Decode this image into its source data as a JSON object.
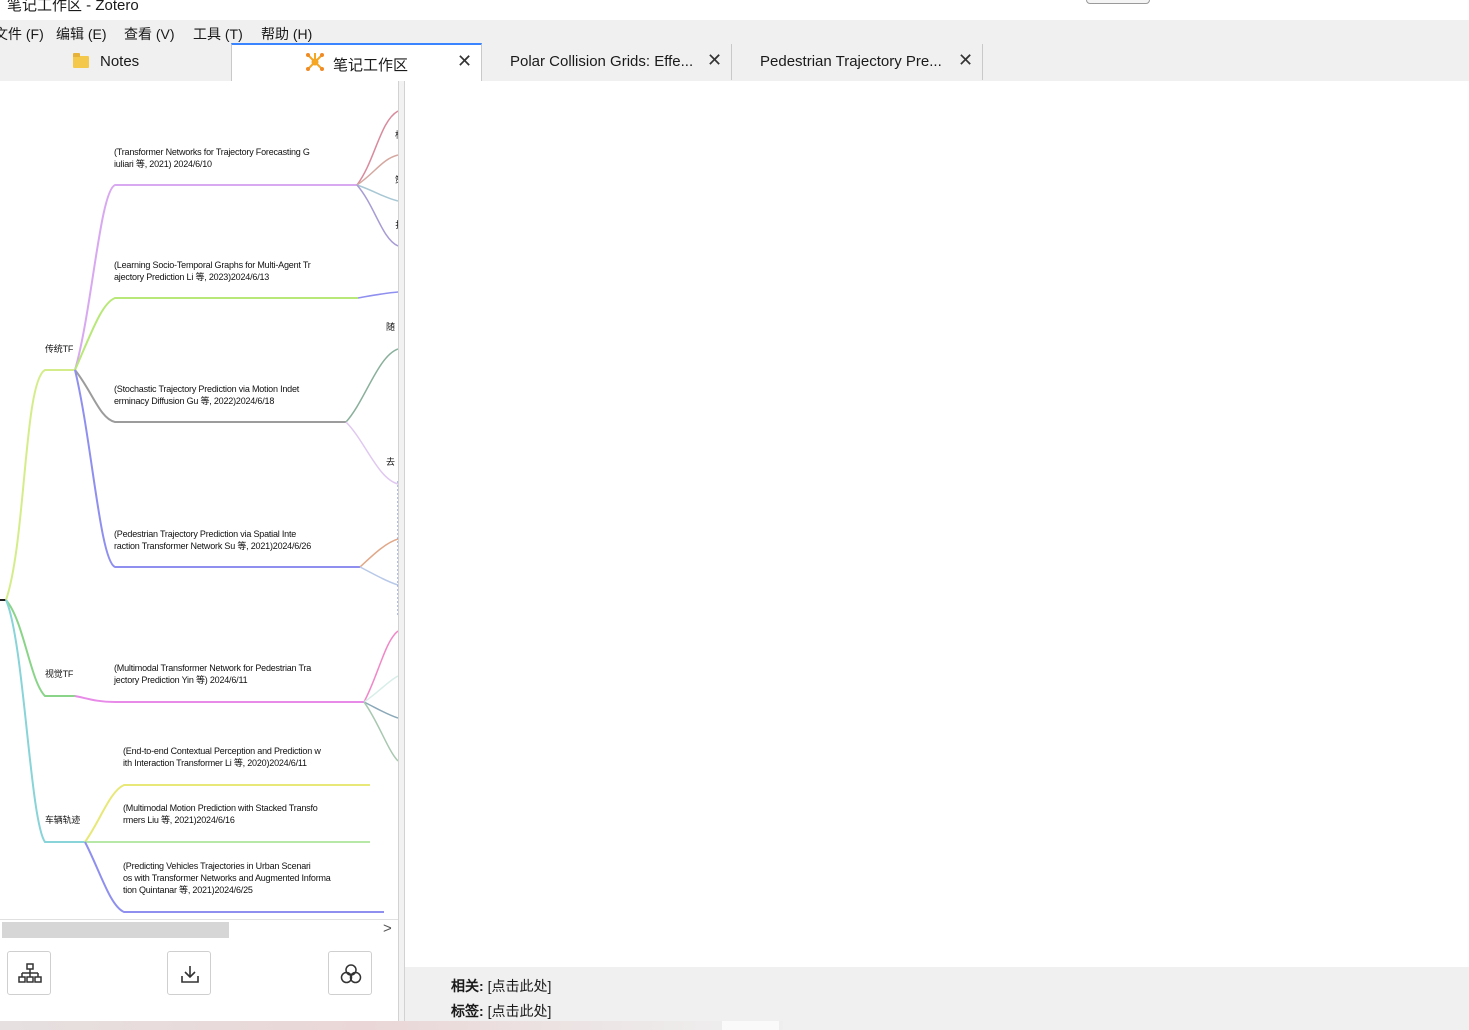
{
  "window": {
    "title": "笔记工作区 - Zotero"
  },
  "menu": {
    "file": "文件 (F)",
    "edit": "编辑 (E)",
    "view": "查看 (V)",
    "tools": "工具 (T)",
    "help": "帮助 (H)"
  },
  "tabs": [
    {
      "label": "Notes",
      "icon": "folder-icon"
    },
    {
      "label": "笔记工作区",
      "icon": "burst-icon",
      "active": true
    },
    {
      "label": "Polar Collision Grids: Effe..."
    },
    {
      "label": "Pedestrian Trajectory Pre..."
    }
  ],
  "close_glyph": "✕",
  "mindmap": {
    "branch_traditional": "传统TF",
    "branch_visual": "视觉TF",
    "branch_vehicle": "车辆轨迹",
    "nodes": [
      {
        "line1": "(Transformer Networks for Trajectory Forecasting G",
        "line2": "iuliari 等, 2021) 2024/6/10"
      },
      {
        "line1": "(Learning Socio-Temporal Graphs for Multi-Agent Tr",
        "line2": "ajectory Prediction Li 等, 2023)2024/6/13"
      },
      {
        "line1": "(Stochastic Trajectory Prediction via Motion Indet",
        "line2": "erminacy Diffusion Gu 等, 2022)2024/6/18"
      },
      {
        "line1": "(Pedestrian Trajectory Prediction via Spatial Inte",
        "line2": "raction Transformer Network Su 等, 2021)2024/6/26"
      },
      {
        "line1": "(Multimodal Transformer Network for Pedestrian Tra",
        "line2": "jectory Prediction Yin 等) 2024/6/11"
      },
      {
        "line1": "(End-to-end Contextual Perception and Prediction w",
        "line2": "ith Interaction Transformer Li 等, 2020)2024/6/11"
      },
      {
        "line1": "(Multimodal Motion Prediction with Stacked Transfo",
        "line2": "rmers Liu 等, 2021)2024/6/16"
      },
      {
        "line1": "(Predicting Vehicles Trajectories in Urban Scenari",
        "line2": "os with Transformer Networks and Augmented Informa",
        "line3": "tion Quintanar 等, 2021)2024/6/25"
      }
    ],
    "edge_fragments": [
      "梢",
      "策",
      "扌",
      "随",
      "去"
    ]
  },
  "scroll_arrow": ">",
  "toolbar": {
    "layout_button": "layout-icon",
    "download_button": "download-icon",
    "theme_button": "circles-icon"
  },
  "footer": {
    "related_label": "相关:",
    "related_value": "[点击此处]",
    "tags_label": "标签:",
    "tags_value": "[点击此处]"
  }
}
